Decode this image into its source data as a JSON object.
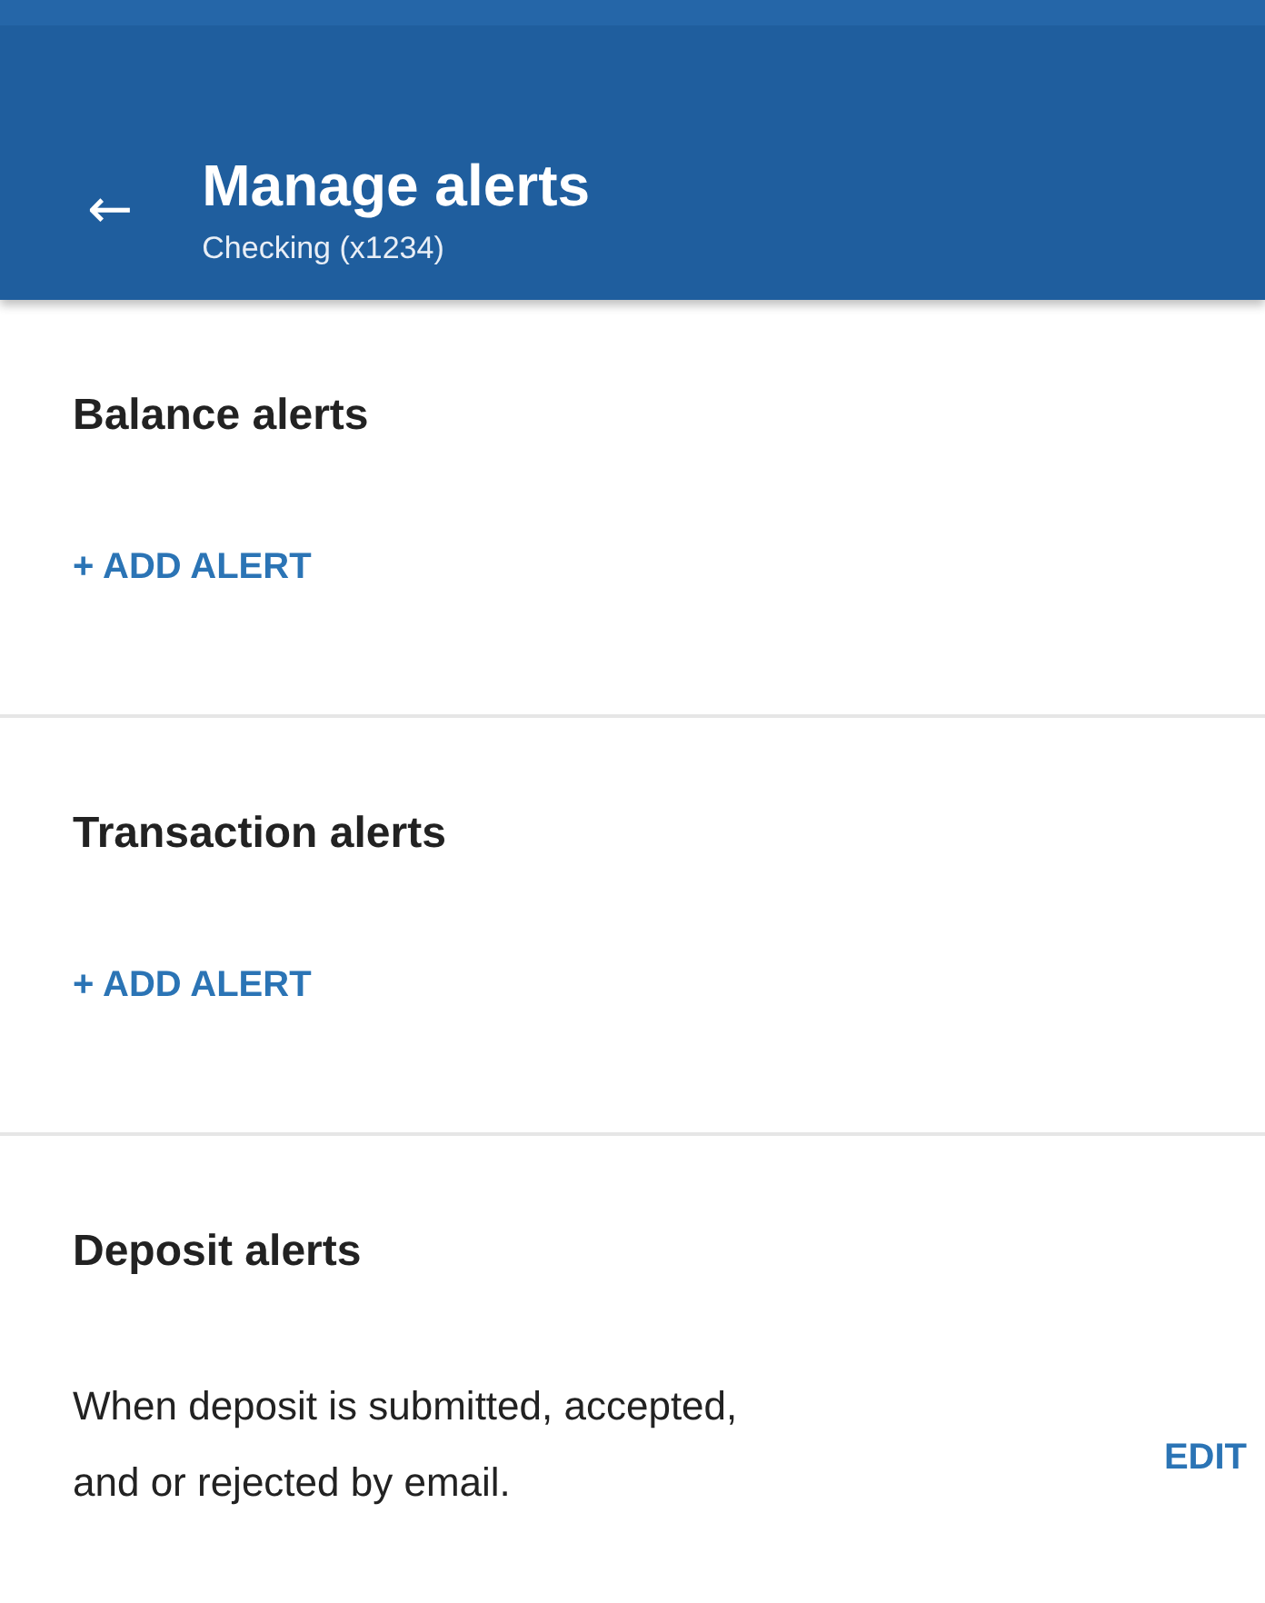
{
  "header": {
    "back": "←",
    "title": "Manage alerts",
    "subtitle": "Checking (x1234)"
  },
  "sections": [
    {
      "title": "Balance alerts",
      "kind": "add",
      "action": "+ ADD ALERT"
    },
    {
      "title": "Transaction alerts",
      "kind": "add",
      "action": "+ ADD ALERT"
    },
    {
      "title": "Deposit alerts",
      "kind": "rule",
      "description": "When deposit is submitted, accepted, and or rejected by email.",
      "action": "EDIT"
    }
  ]
}
